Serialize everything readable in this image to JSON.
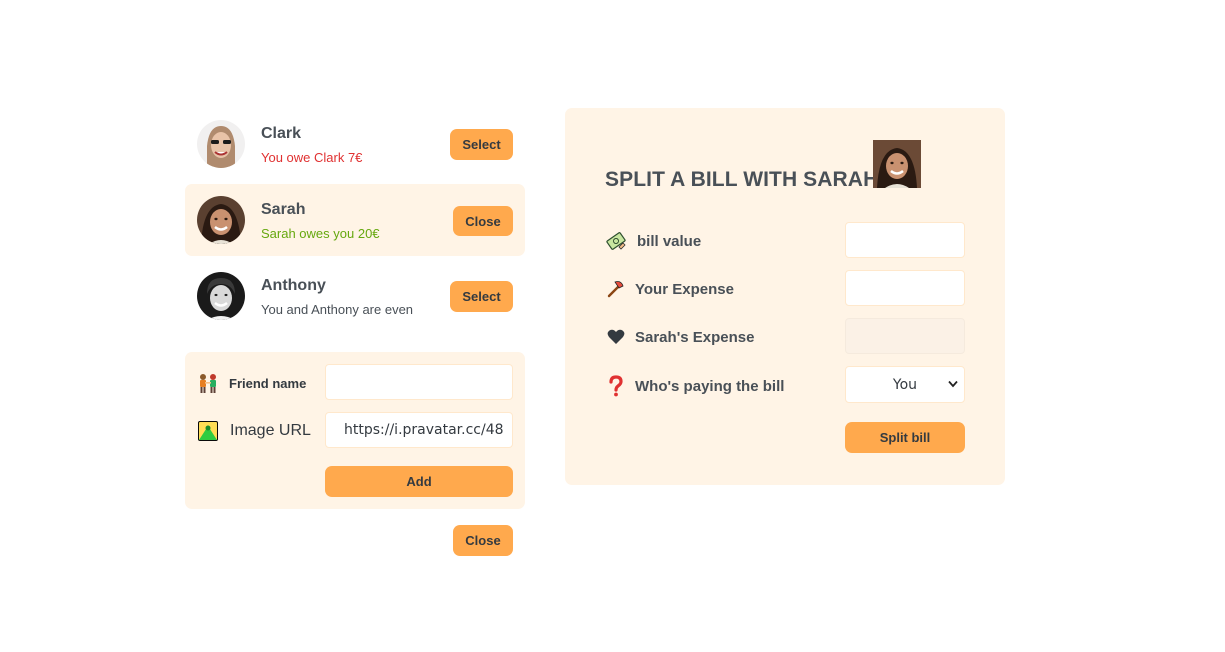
{
  "friends": [
    {
      "name": "Clark",
      "status": "You owe Clark 7€",
      "button": "Select"
    },
    {
      "name": "Sarah",
      "status": "Sarah owes you 20€",
      "button": "Close"
    },
    {
      "name": "Anthony",
      "status": "You and Anthony are even",
      "button": "Select"
    }
  ],
  "add_friend": {
    "name_label": "Friend name",
    "name_value": "",
    "image_label": "Image URL",
    "image_value": "https://i.pravatar.cc/48",
    "add_button": "Add"
  },
  "close_button": "Close",
  "split": {
    "title": "SPLIT A BILL WITH SARAH",
    "bill_label": "bill value",
    "bill_value": "",
    "your_label": "Your Expense",
    "your_value": "",
    "friend_label": "Sarah's Expense",
    "friend_value": "",
    "payer_label": "Who's paying the bill",
    "payer_selected": "You",
    "button": "Split bill"
  },
  "colors": {
    "accent": "#ffa94d",
    "panel": "#fff4e6",
    "owe": "#e03131",
    "owed": "#66a80f",
    "text": "#495057"
  },
  "icons": {
    "friend_name": "people-holding-hands-icon",
    "image_url": "mountain-icon",
    "bill_value": "money-icon",
    "your_expense": "axe-icon",
    "friend_expense": "heart-icon",
    "payer": "question-mark-icon"
  }
}
